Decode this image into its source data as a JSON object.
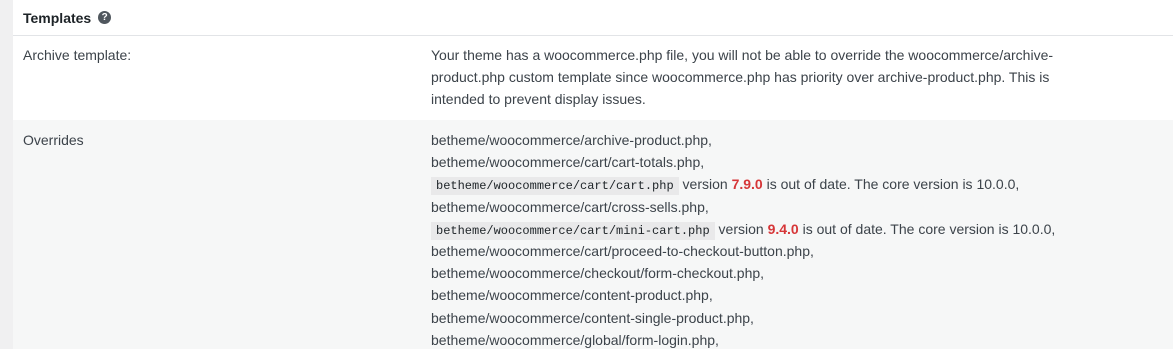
{
  "section": {
    "title": "Templates",
    "help_icon": "question-icon"
  },
  "archive": {
    "label": "Archive template:",
    "lines": [
      "Your theme has a woocommerce.php file, you will not be able to override the woocommerce/archive-",
      "product.php custom template since woocommerce.php has priority over archive-product.php. This is",
      "intended to prevent display issues."
    ]
  },
  "overrides": {
    "label": "Overrides",
    "items": [
      "betheme/woocommerce/archive-product.php,",
      "betheme/woocommerce/cart/cart-totals.php,",
      "betheme/woocommerce/cart/cart.php",
      "betheme/woocommerce/cart/cross-sells.php,",
      "betheme/woocommerce/cart/mini-cart.php",
      "betheme/woocommerce/cart/proceed-to-checkout-button.php,",
      "betheme/woocommerce/checkout/form-checkout.php,",
      "betheme/woocommerce/content-product.php,",
      "betheme/woocommerce/content-single-product.php,",
      "betheme/woocommerce/global/form-login.php,"
    ],
    "outdated": [
      {
        "prefix": "version",
        "version": "7.9.0",
        "suffix": "is out of date. The core version is 10.0.0,"
      },
      {
        "prefix": "version",
        "version": "9.4.0",
        "suffix": "is out of date. The core version is 10.0.0,"
      }
    ]
  },
  "colors": {
    "outdated_version": "#d63638"
  }
}
